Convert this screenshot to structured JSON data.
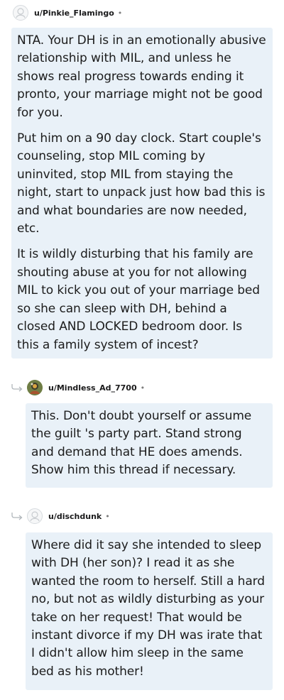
{
  "comments": [
    {
      "username": "u/Pinkie_Flamingo",
      "separator": "•",
      "avatar": "default-avatar-icon",
      "paragraphs": [
        "NTA. Your DH is in an emotionally abusive relationship with MIL, and unless he shows real progress towards ending it pronto, your marriage might not be good for you.",
        "Put him on a 90 day clock. Start couple's counseling, stop MIL coming by uninvited, stop MIL from staying the night, start to unpack just how bad this is and what boundaries are now needed, etc.",
        "It is wildly disturbing that his family are shouting abuse at you for not allowing MIL to kick you out of your marriage bed so she can sleep with DH, behind a closed AND LOCKED bedroom door. Is this a family system of incest?"
      ]
    },
    {
      "username": "u/Mindless_Ad_7700",
      "separator": "•",
      "avatar": "user-photo-avatar",
      "paragraphs": [
        "This. Don't doubt yourself or assume the guilt 's party part. Stand strong and demand that HE does amends. Show him this thread if necessary."
      ]
    },
    {
      "username": "u/dischdunk",
      "separator": "•",
      "avatar": "default-avatar-icon",
      "paragraphs": [
        "Where did it say she intended to sleep with DH (her son)? I read it as she wanted the room to herself. Still a hard no, but not as wildly disturbing as your take on her request! That would be instant divorce if my DH was irate that I didn't allow him sleep in the same bed as his mother!"
      ]
    }
  ],
  "colors": {
    "bubble_bg": "#e9f1f8",
    "text": "#1c1c1c",
    "meta": "#7c7c7c"
  }
}
